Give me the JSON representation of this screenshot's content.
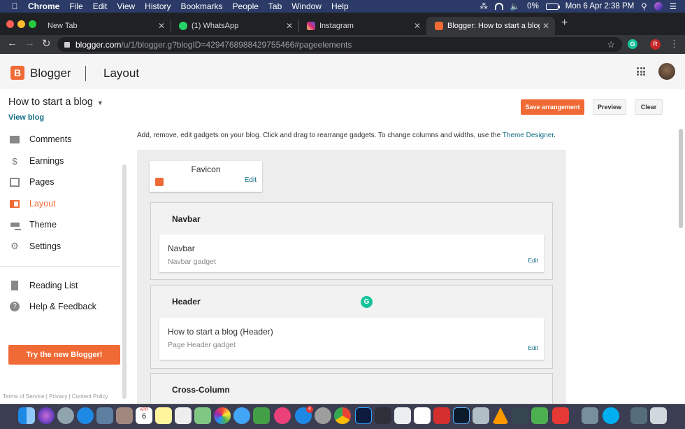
{
  "menubar": {
    "app": "Chrome",
    "items": [
      "File",
      "Edit",
      "View",
      "History",
      "Bookmarks",
      "People",
      "Tab",
      "Window",
      "Help"
    ],
    "battery": "0%",
    "clock": "Mon 6 Apr  2:38 PM"
  },
  "tabs": [
    {
      "label": "New Tab"
    },
    {
      "label": "(1) WhatsApp"
    },
    {
      "label": "Instagram"
    },
    {
      "label": "Blogger: How to start a blog - L"
    }
  ],
  "address": {
    "host": "blogger.com",
    "path": "/u/1/blogger.g?blogID=4294768988429755466#pageelements"
  },
  "extensions": {
    "profile_initial": "R",
    "grammarly": "G"
  },
  "header": {
    "logo_letter": "B",
    "brand": "Blogger",
    "section": "Layout"
  },
  "blog": {
    "title": "How to start a blog",
    "view_link": "View blog"
  },
  "actions": {
    "save": "Save arrangement",
    "preview": "Preview",
    "clear": "Clear"
  },
  "sidebar": {
    "items": [
      {
        "label": "Comments",
        "icon": "comment-icon"
      },
      {
        "label": "Earnings",
        "icon": "dollar-icon"
      },
      {
        "label": "Pages",
        "icon": "pages-icon"
      },
      {
        "label": "Layout",
        "icon": "layout-icon",
        "active": true
      },
      {
        "label": "Theme",
        "icon": "paint-roller-icon"
      },
      {
        "label": "Settings",
        "icon": "gear-icon"
      },
      {
        "label": "Reading List",
        "icon": "bookmark-icon"
      },
      {
        "label": "Help & Feedback",
        "icon": "help-icon"
      }
    ],
    "try_button": "Try the new Blogger!",
    "footer": [
      "Terms of Service",
      "Privacy",
      "Content Policy"
    ]
  },
  "main": {
    "intro": "Add, remove, edit gadgets on your blog. Click and drag to rearrange gadgets. To change columns and widths, use the",
    "intro_link": "Theme Designer",
    "intro_end": ".",
    "favicon": {
      "title": "Favicon",
      "edit": "Edit"
    },
    "sections": [
      {
        "title": "Navbar",
        "gadget": {
          "title": "Navbar",
          "subtitle": "Navbar gadget",
          "edit": "Edit"
        }
      },
      {
        "title": "Header",
        "gadget": {
          "title": "How to start a blog (Header)",
          "subtitle": "Page Header gadget",
          "edit": "Edit"
        }
      },
      {
        "title": "Cross-Column"
      }
    ]
  },
  "dock": {
    "calendar_month": "APR",
    "calendar_day": "6",
    "mail_badge": "4"
  },
  "colors": {
    "accent": "#f06a35",
    "link": "#116d84",
    "menubar": "#2b3a66",
    "tabbar": "#202124"
  }
}
